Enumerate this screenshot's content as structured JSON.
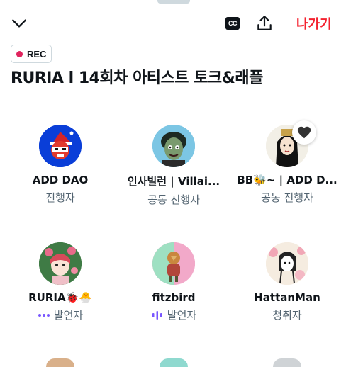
{
  "header": {
    "cc_label": "CC",
    "leave_label": "나가기"
  },
  "space": {
    "rec_label": "REC",
    "title": "RURIA l 14회차 아티스트 토크&래플"
  },
  "speakers": [
    {
      "name": "ADD DAO",
      "role": "진행자"
    },
    {
      "name": "인사빌런 | Villai...",
      "role": "공동 진행자"
    },
    {
      "name": "BB🐝~ | ADD D...",
      "role": "공동 진행자"
    },
    {
      "name": "RURIA🐞🐣",
      "role": "발언자"
    },
    {
      "name": "fitzbird",
      "role": "발언자"
    },
    {
      "name": "HattanMan",
      "role": "청취자"
    }
  ],
  "colors": {
    "accent_red": "#f4212e",
    "rec_dot": "#e0245e",
    "speaking_indicator": "#7856ff"
  }
}
